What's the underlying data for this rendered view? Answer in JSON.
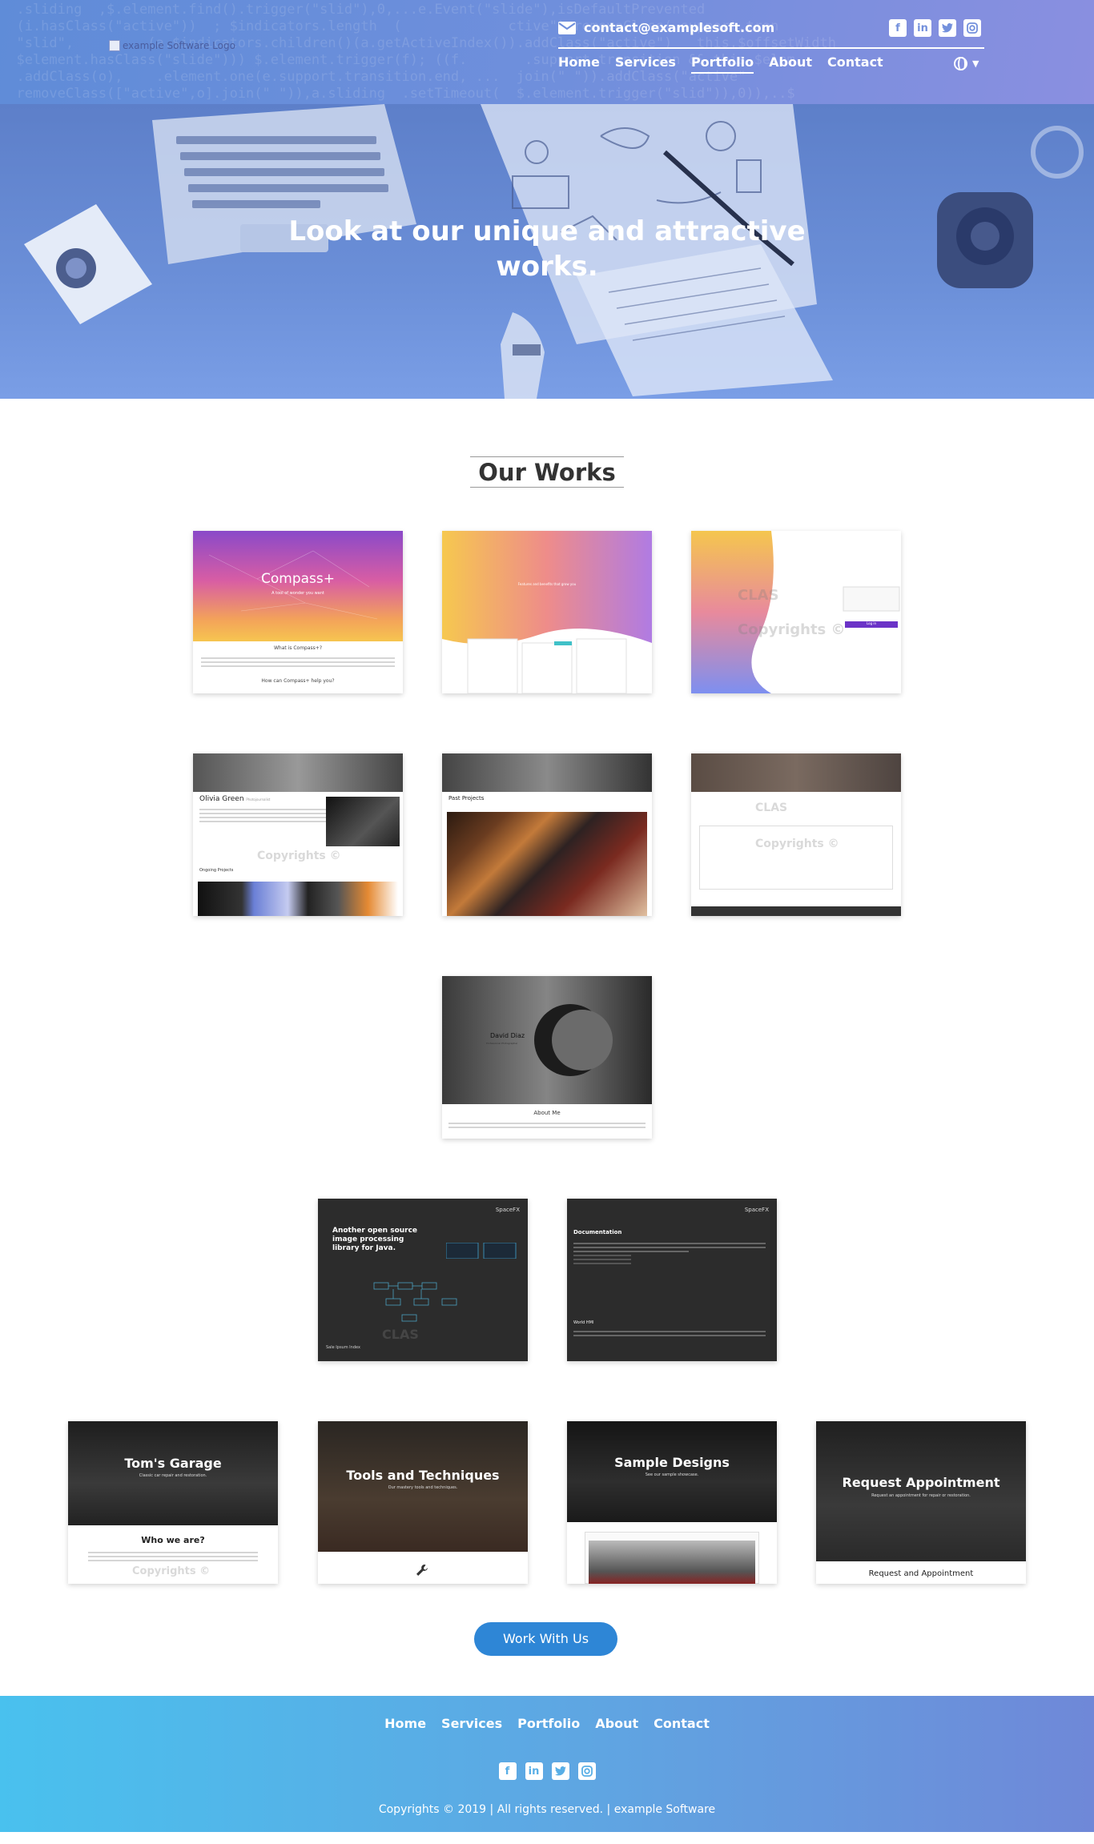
{
  "header": {
    "logo_alt": "example Software Logo",
    "email": "contact@examplesoft.com",
    "social": [
      "facebook-icon",
      "linkedin-icon",
      "twitter-icon",
      "instagram-icon"
    ],
    "code_background": "  .sliding  ,$.element.find().trigger(\"slid\"),0,...e.Event(\"slide\"),isDefaultPrevented\n  (i.hasClass(\"active\"))  ; $indicators.length  (             ctive\").removeClass( support.tran\n  \"slid\",         (a.$indicators.children()(a.getActiveIndex()).addClass(\"active\")   this.$offsetWidth\n  $element.hasClass(\"slide\"))) $.element.trigger(f); ((f.       .support.transition && this.$elem\n  .addClass(o),    .element.one(e.support.transition.end, ...  join(\" \")).addClass(\"active\"\n  removeClass([\"active\",o].join(\" \")),a.sliding  .setTimeout(  $.element.trigger(\"slid\")),0)),..$"
  },
  "nav": {
    "items": [
      {
        "label": "Home"
      },
      {
        "label": "Services"
      },
      {
        "label": "Portfolio",
        "active": true
      },
      {
        "label": "About"
      },
      {
        "label": "Contact"
      }
    ]
  },
  "hero": {
    "title": "Look at our unique and attractive works."
  },
  "works": {
    "title": "Our Works",
    "cards": [
      {
        "id": "compass-landing",
        "heading": "Compass+",
        "sub": "A tool of wonder you want",
        "body_title": "What is Compass+?",
        "body_title2": "How can Compass+ help you?"
      },
      {
        "id": "compass-pricing",
        "tagline": "Features and benefits that grow you"
      },
      {
        "id": "compass-login",
        "login_button": "Log in"
      },
      {
        "id": "olivia-home",
        "name": "Olivia Green",
        "role": "Photojournalist",
        "section": "Ongoing Projects"
      },
      {
        "id": "olivia-projects",
        "section": "Past Projects"
      },
      {
        "id": "olivia-contact"
      },
      {
        "id": "david-diaz",
        "name": "David Diaz",
        "sub": "Professional Photographer",
        "section": "About Me"
      },
      {
        "id": "spacefx-home",
        "brand": "SpaceFX",
        "heading": "Another open source image processing library for Java.",
        "bottom": "Sale Ipsum Index"
      },
      {
        "id": "spacefx-docs",
        "brand": "SpaceFX",
        "heading": "Documentation",
        "sub2": "World HMI"
      },
      {
        "id": "toms-garage",
        "heading": "Tom's Garage",
        "sub": "Classic car repair and restoration.",
        "body_title": "Who we are?"
      },
      {
        "id": "tools",
        "heading": "Tools and Techniques",
        "sub": "Our mastery tools and techniques."
      },
      {
        "id": "sample-designs",
        "heading": "Sample Designs",
        "sub": "See our sample showcase."
      },
      {
        "id": "request-appointment",
        "heading": "Request Appointment",
        "sub": "Request an appointment for repair or restoration.",
        "body_title": "Request and Appointment"
      }
    ],
    "watermark": "Copyrights ©",
    "watermark_logo": "CLAS"
  },
  "cta": {
    "label": "Work With Us"
  },
  "footer": {
    "nav": [
      "Home",
      "Services",
      "Portfolio",
      "About",
      "Contact"
    ],
    "social": [
      "facebook-icon",
      "linkedin-icon",
      "twitter-icon",
      "instagram-icon"
    ],
    "copyright": "Copyrights © 2019 | All rights reserved. | example Software"
  },
  "colors": {
    "header_gradient_start": "#5f8cd8",
    "header_gradient_end": "#8a8fe0",
    "hero_overlay": "#6b8fd8",
    "cta": "#2e86d6",
    "footer_gradient_start": "#49c1ee",
    "footer_gradient_end": "#6f88d8"
  }
}
